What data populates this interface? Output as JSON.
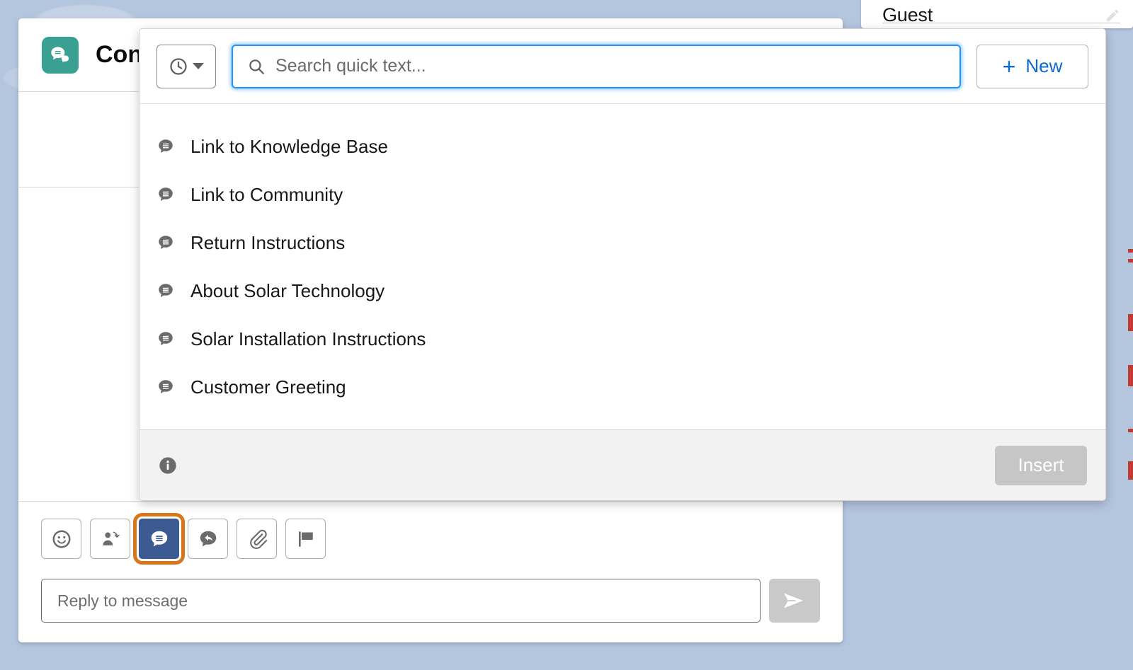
{
  "background": {
    "color": "#b4c5de"
  },
  "guest_panel": {
    "name": "Guest",
    "edit_icon": "pencil-icon"
  },
  "conversation": {
    "title": "Conv",
    "logo_icon": "chat-bubbles-icon",
    "logo_color": "#3aa092"
  },
  "composer": {
    "tools": [
      {
        "name": "emoji",
        "icon": "smiley-icon",
        "active": false
      },
      {
        "name": "transfer",
        "icon": "person-transfer-icon",
        "active": false
      },
      {
        "name": "quick-text",
        "icon": "quick-text-bubble-icon",
        "active": true
      },
      {
        "name": "reply",
        "icon": "chat-reply-icon",
        "active": false
      },
      {
        "name": "attach",
        "icon": "paperclip-icon",
        "active": false
      },
      {
        "name": "flag",
        "icon": "flag-icon",
        "active": false
      }
    ],
    "active_tool_border_color": "#d8771a",
    "active_tool_fill_color": "#3c5a92",
    "reply_placeholder": "Reply to message",
    "reply_value": "",
    "send_icon": "send-paper-plane-icon",
    "send_disabled": true
  },
  "quick_text": {
    "history_button": {
      "icon": "clock-icon",
      "caret": "chevron-down-icon"
    },
    "search": {
      "icon": "search-icon",
      "placeholder": "Search quick text...",
      "value": "",
      "focused": true,
      "focus_color": "#1b96ff"
    },
    "new_button": {
      "label": "New",
      "icon": "plus-icon",
      "color": "#0b6ad2"
    },
    "items": [
      {
        "label": "Link to Knowledge Base",
        "icon": "quick-text-bubble-icon"
      },
      {
        "label": "Link to Community",
        "icon": "quick-text-bubble-icon"
      },
      {
        "label": "Return Instructions",
        "icon": "quick-text-bubble-icon"
      },
      {
        "label": "About Solar Technology",
        "icon": "quick-text-bubble-icon"
      },
      {
        "label": "Solar Installation Instructions",
        "icon": "quick-text-bubble-icon"
      },
      {
        "label": "Customer Greeting",
        "icon": "quick-text-bubble-icon"
      }
    ],
    "footer": {
      "info_icon": "info-circle-icon",
      "insert_label": "Insert",
      "insert_disabled": true
    }
  }
}
